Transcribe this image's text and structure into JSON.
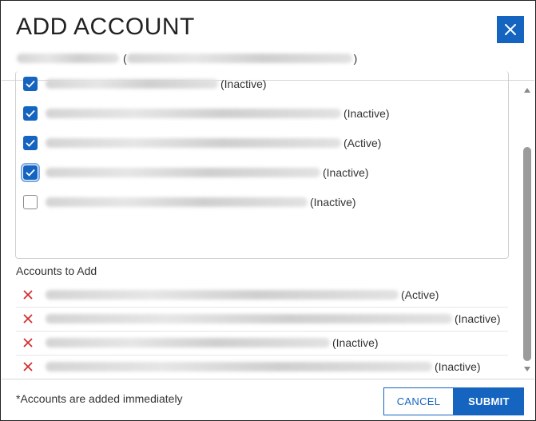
{
  "dialog": {
    "title": "ADD ACCOUNT",
    "subtitle_open": "(",
    "subtitle_close": ")",
    "close_icon": "close-icon"
  },
  "account_list": [
    {
      "checked": true,
      "status": "(Inactive)"
    },
    {
      "checked": true,
      "status": "(Inactive)"
    },
    {
      "checked": true,
      "status": "(Active)"
    },
    {
      "checked": true,
      "status": "(Inactive)"
    },
    {
      "checked": false,
      "status": "(Inactive)"
    }
  ],
  "accounts_to_add": {
    "label": "Accounts to Add",
    "items": [
      {
        "status": "(Active)"
      },
      {
        "status": "(Inactive)"
      },
      {
        "status": "(Inactive)"
      },
      {
        "status": "(Inactive)"
      }
    ]
  },
  "footer": {
    "note": "*Accounts are added immediately",
    "cancel_label": "CANCEL",
    "submit_label": "SUBMIT"
  },
  "colors": {
    "primary": "#1565c0",
    "remove": "#d32f2f"
  }
}
